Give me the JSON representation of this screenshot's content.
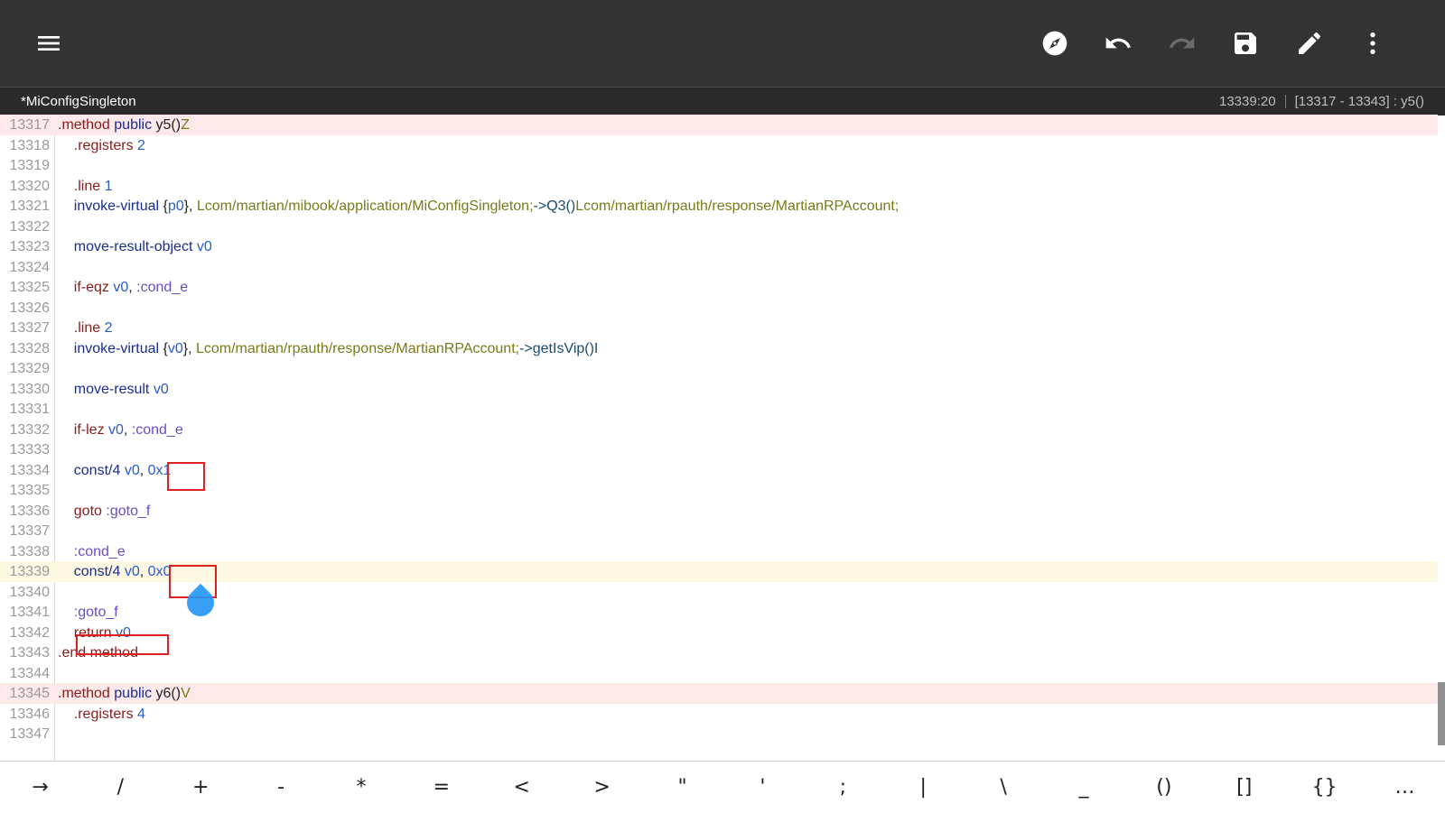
{
  "toolbar": {
    "icons": [
      "menu-icon",
      "compass-icon",
      "undo-icon",
      "redo-icon",
      "save-icon",
      "edit-icon",
      "more-vert-icon"
    ]
  },
  "tab": {
    "title": "*MiConfigSingleton",
    "cursor": "13339:20",
    "range": "[13317 - 13343] : y5()"
  },
  "lines": [
    {
      "n": "13317",
      "c": [
        [
          ".method",
          "dir"
        ],
        [
          " ",
          "pun"
        ],
        [
          "public",
          "op"
        ],
        [
          " ",
          "pun"
        ],
        [
          "y5()",
          "pun"
        ],
        [
          "Z",
          "ret"
        ]
      ],
      "hl": "method"
    },
    {
      "n": "13318",
      "c": [
        [
          "    .registers",
          "dir"
        ],
        [
          " ",
          "pun"
        ],
        [
          "2",
          "reg"
        ]
      ]
    },
    {
      "n": "13319",
      "c": []
    },
    {
      "n": "13320",
      "c": [
        [
          "    .line",
          "dir"
        ],
        [
          " ",
          "pun"
        ],
        [
          "1",
          "reg"
        ]
      ]
    },
    {
      "n": "13321",
      "c": [
        [
          "    invoke-virtual",
          "op"
        ],
        [
          " {",
          "pun"
        ],
        [
          "p0",
          "reg"
        ],
        [
          "}, ",
          "pun"
        ],
        [
          "Lcom/martian/mibook/application/MiConfigSingleton;",
          "cls"
        ],
        [
          "->Q3()",
          "meth"
        ],
        [
          "Lcom/martian/rpauth/response/MartianRPAccount;",
          "cls"
        ]
      ]
    },
    {
      "n": "13322",
      "c": []
    },
    {
      "n": "13323",
      "c": [
        [
          "    move-result-object",
          "op"
        ],
        [
          " ",
          "pun"
        ],
        [
          "v0",
          "reg"
        ]
      ]
    },
    {
      "n": "13324",
      "c": []
    },
    {
      "n": "13325",
      "c": [
        [
          "    if-eqz",
          "kw"
        ],
        [
          " ",
          "pun"
        ],
        [
          "v0",
          "reg"
        ],
        [
          ", ",
          "pun"
        ],
        [
          ":cond_e",
          "lbl"
        ]
      ]
    },
    {
      "n": "13326",
      "c": []
    },
    {
      "n": "13327",
      "c": [
        [
          "    .line",
          "dir"
        ],
        [
          " ",
          "pun"
        ],
        [
          "2",
          "reg"
        ]
      ]
    },
    {
      "n": "13328",
      "c": [
        [
          "    invoke-virtual",
          "op"
        ],
        [
          " {",
          "pun"
        ],
        [
          "v0",
          "reg"
        ],
        [
          "}, ",
          "pun"
        ],
        [
          "Lcom/martian/rpauth/response/MartianRPAccount;",
          "cls"
        ],
        [
          "->getIsVip()I",
          "meth"
        ]
      ]
    },
    {
      "n": "13329",
      "c": []
    },
    {
      "n": "13330",
      "c": [
        [
          "    move-result",
          "op"
        ],
        [
          " ",
          "pun"
        ],
        [
          "v0",
          "reg"
        ]
      ]
    },
    {
      "n": "13331",
      "c": []
    },
    {
      "n": "13332",
      "c": [
        [
          "    if-lez",
          "kw"
        ],
        [
          " ",
          "pun"
        ],
        [
          "v0",
          "reg"
        ],
        [
          ", ",
          "pun"
        ],
        [
          ":cond_e",
          "lbl"
        ]
      ]
    },
    {
      "n": "13333",
      "c": []
    },
    {
      "n": "13334",
      "c": [
        [
          "    const/4",
          "op"
        ],
        [
          " ",
          "pun"
        ],
        [
          "v0",
          "reg"
        ],
        [
          ", ",
          "pun"
        ],
        [
          "0x1",
          "reg"
        ]
      ]
    },
    {
      "n": "13335",
      "c": []
    },
    {
      "n": "13336",
      "c": [
        [
          "    goto",
          "kw"
        ],
        [
          " ",
          "pun"
        ],
        [
          ":goto_f",
          "lbl"
        ]
      ]
    },
    {
      "n": "13337",
      "c": []
    },
    {
      "n": "13338",
      "c": [
        [
          "    :cond_e",
          "lbl"
        ]
      ]
    },
    {
      "n": "13339",
      "c": [
        [
          "    const/4",
          "op"
        ],
        [
          " ",
          "pun"
        ],
        [
          "v0",
          "reg"
        ],
        [
          ", ",
          "pun"
        ],
        [
          "0x0",
          "reg"
        ]
      ],
      "hl": "cur"
    },
    {
      "n": "13340",
      "c": []
    },
    {
      "n": "13341",
      "c": [
        [
          "    :goto_f",
          "lbl"
        ]
      ]
    },
    {
      "n": "13342",
      "c": [
        [
          "    return",
          "kw"
        ],
        [
          " ",
          "pun"
        ],
        [
          "v0",
          "reg"
        ]
      ]
    },
    {
      "n": "13343",
      "c": [
        [
          ".end",
          "dir"
        ],
        [
          " ",
          "pun"
        ],
        [
          "method",
          "dir"
        ]
      ]
    },
    {
      "n": "13344",
      "c": []
    },
    {
      "n": "13345",
      "c": [
        [
          ".method",
          "dir"
        ],
        [
          " ",
          "pun"
        ],
        [
          "public",
          "op"
        ],
        [
          " ",
          "pun"
        ],
        [
          "y6()",
          "pun"
        ],
        [
          "V",
          "ret"
        ]
      ],
      "hl": "method"
    },
    {
      "n": "13346",
      "c": [
        [
          "    .registers",
          "dir"
        ],
        [
          " ",
          "pun"
        ],
        [
          "4",
          "reg"
        ]
      ]
    },
    {
      "n": "13347",
      "c": []
    }
  ],
  "keys": [
    "→",
    "/",
    "+",
    "-",
    "*",
    "=",
    "<",
    ">",
    "\"",
    "'",
    ";",
    "|",
    "\\",
    "_",
    "()",
    "[]",
    "{}",
    "…"
  ]
}
